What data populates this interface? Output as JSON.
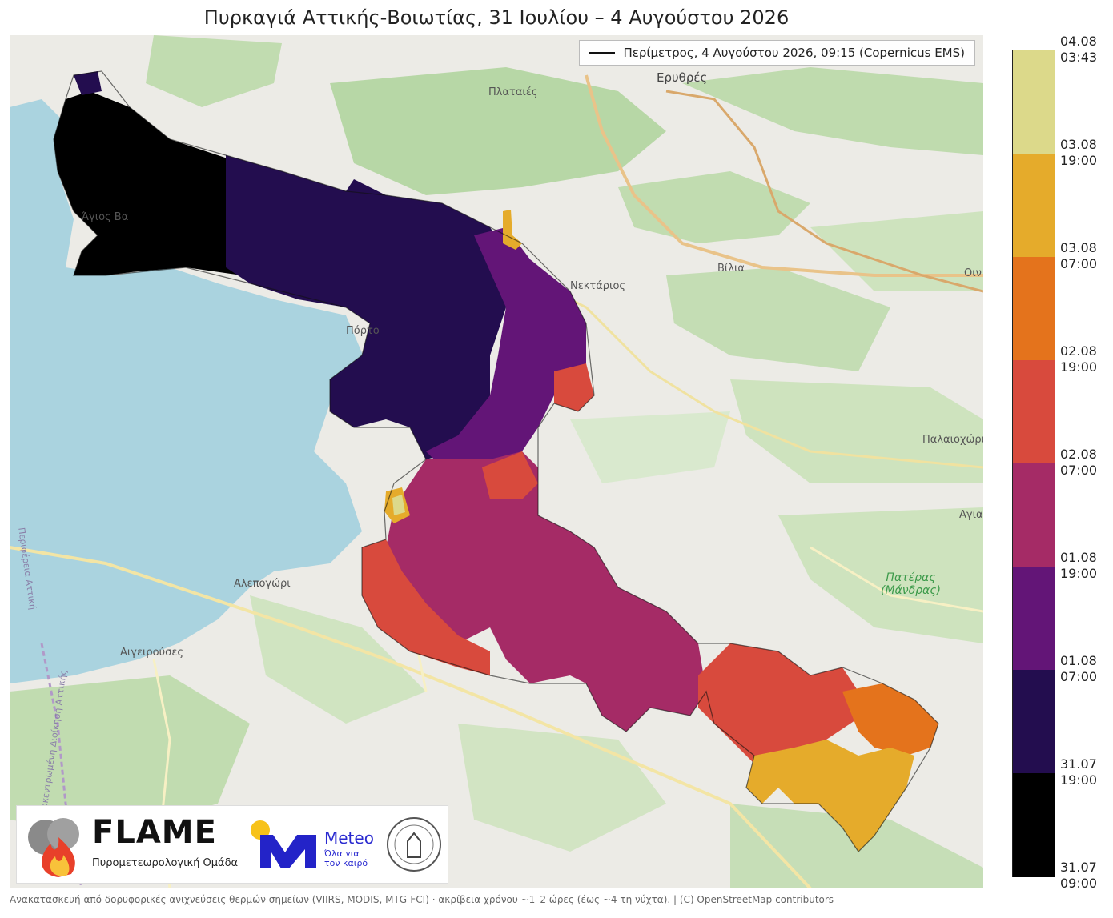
{
  "title": "Πυρκαγιά Αττικής-Βοιωτίας, 31 Ιουλίου – 4 Αυγούστου 2026",
  "legend": {
    "perimeter_label": "Περίμετρος, 4 Αυγούστου 2026, 09:15 (Copernicus EMS)"
  },
  "places": {
    "erythres": "Ερυθρές",
    "plataies": "Πλαταιές",
    "agios_vasileios": "Άγιος Βα",
    "nektarios": "Νεκτάριος",
    "vilia": "Βίλια",
    "oinoi": "Οιν",
    "porto": "Πόρτο",
    "palaiochori": "Παλαιοχώρι",
    "agia": "Αγια",
    "aleponori": "Αλεπογώρι",
    "aigeiroyses": "Αιγειρούσες",
    "pateras_line1": "Πατέρας",
    "pateras_line2": "(Μάνδρας)",
    "perifereia": "Περιφέρεια Αττική",
    "dytiki_attiki": "Αποκεντρωμένη Διοίκηση Αττικής"
  },
  "logos": {
    "flame": "FLAME",
    "flame_sub": "Πυρομετεωρολογική Ομάδα",
    "meteo": "Meteo",
    "meteo_sub_line1": "Όλα για",
    "meteo_sub_line2": "τον καιρό"
  },
  "colorbar": {
    "ticks": [
      {
        "date": "04.08",
        "time": "03:43"
      },
      {
        "date": "03.08",
        "time": "19:00"
      },
      {
        "date": "03.08",
        "time": "07:00"
      },
      {
        "date": "02.08",
        "time": "19:00"
      },
      {
        "date": "02.08",
        "time": "07:00"
      },
      {
        "date": "01.08",
        "time": "19:00"
      },
      {
        "date": "01.08",
        "time": "07:00"
      },
      {
        "date": "31.07",
        "time": "19:00"
      },
      {
        "date": "31.07",
        "time": "09:00"
      }
    ],
    "colors": [
      "#dcd98a",
      "#e5ab2b",
      "#e4731c",
      "#d84a3d",
      "#a52b66",
      "#631577",
      "#230d4f",
      "#000000"
    ]
  },
  "caption": "Ανακατασκευή από δορυφορικές ανιχνεύσεις θερμών σημείων (VIIRS, MODIS, MTG-FCI) · ακρίβεια χρόνου ~1–2 ώρες (έως ~4 τη νύχτα). | (C) OpenStreetMap contributors"
}
